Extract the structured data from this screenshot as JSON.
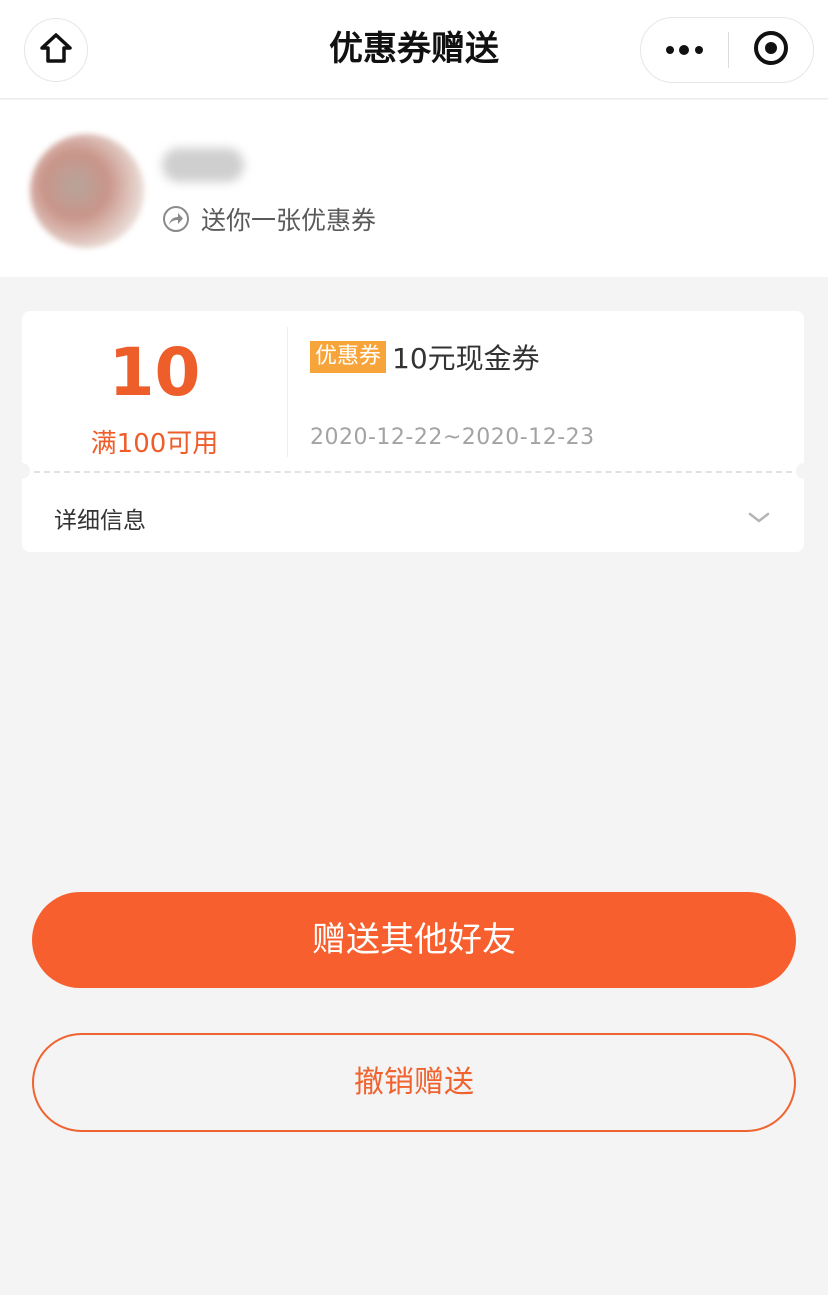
{
  "nav": {
    "title": "优惠券赠送",
    "home_icon": "home-icon",
    "more_icon": "more-dots-icon",
    "close_icon": "target-circle-icon"
  },
  "sender": {
    "message": "送你一张优惠券",
    "share_icon": "share-arrow-icon"
  },
  "coupon": {
    "amount": "10",
    "condition": "满100可用",
    "tag": "优惠券",
    "name": "10元现金券",
    "validity": "2020-12-22~2020-12-23",
    "detail_label": "详细信息",
    "accent_color": "#ee5e2b",
    "tag_color": "#f7a53a"
  },
  "actions": {
    "gift_other": "赠送其他好友",
    "cancel_gift": "撤销赠送"
  }
}
